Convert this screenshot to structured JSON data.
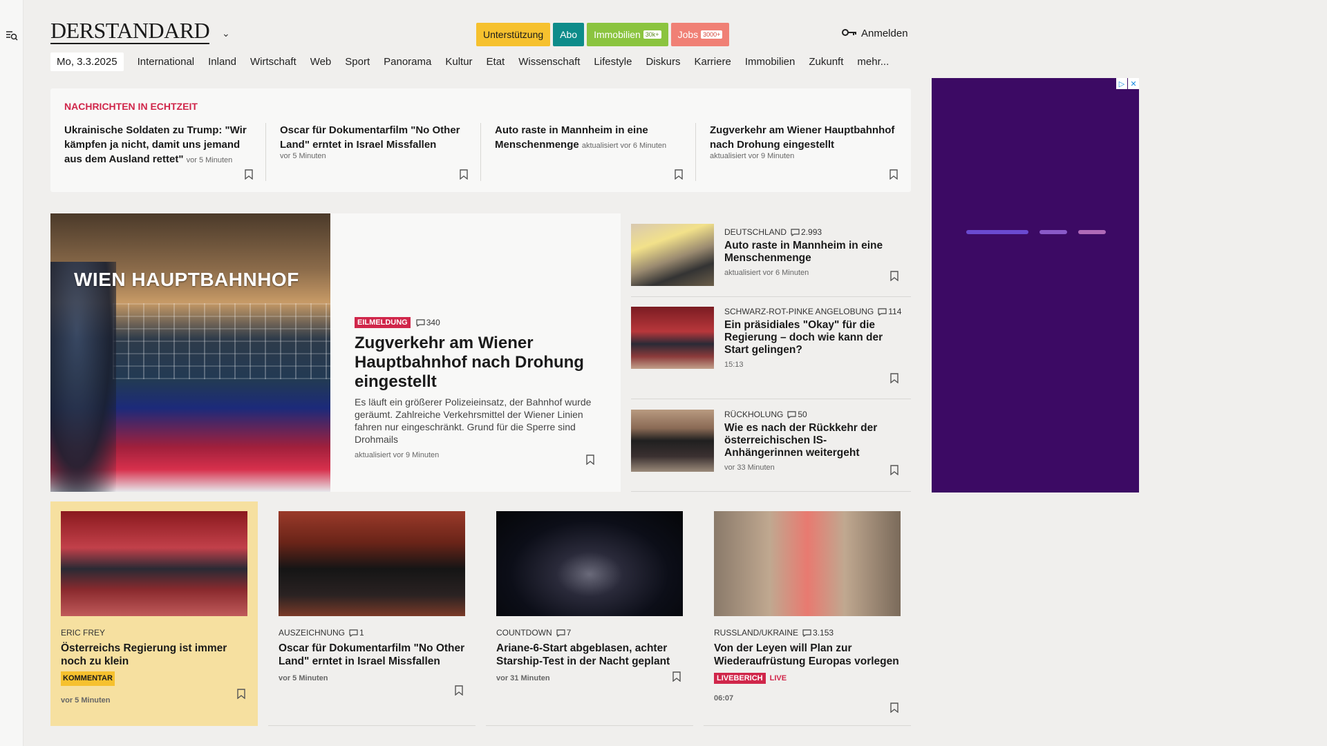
{
  "site": {
    "logo": "DERSTANDARD"
  },
  "top_buttons": {
    "support": "Unterstützung",
    "abo": "Abo",
    "immobilien": "Immobilien",
    "immobilien_tag": "30k+",
    "jobs": "Jobs",
    "jobs_tag": "3000+"
  },
  "login": {
    "label": "Anmelden"
  },
  "nav": {
    "date": "Mo, 3.3.2025",
    "items": [
      "International",
      "Inland",
      "Wirtschaft",
      "Web",
      "Sport",
      "Panorama",
      "Kultur",
      "Etat",
      "Wissenschaft",
      "Lifestyle",
      "Diskurs",
      "Karriere",
      "Immobilien",
      "Zukunft",
      "mehr..."
    ]
  },
  "ticker": {
    "title": "Nachrichten in Echtzeit",
    "items": [
      {
        "headline": "Ukrainische Soldaten zu Trump: \"Wir kämpfen ja nicht, damit uns jemand aus dem Ausland rettet\"",
        "time": "vor 5 Minuten"
      },
      {
        "headline": "Oscar für Dokumentarfilm \"No Other Land\" erntet in Israel Missfallen",
        "time": "vor 5 Minuten"
      },
      {
        "headline": "Auto raste in Mannheim in eine Menschenmenge",
        "time": "aktualisiert vor 6 Minuten"
      },
      {
        "headline": "Zugverkehr am Wiener Hauptbahnhof nach Drohung eingestellt",
        "time": "aktualisiert vor 9 Minuten"
      }
    ]
  },
  "hero": {
    "image_sign": "WIEN HAUPTBAHNHOF",
    "badge": "Eilmeldung",
    "comments": "340",
    "headline": "Zugverkehr am Wiener Hauptbahnhof nach Drohung eingestellt",
    "teaser": "Es läuft ein größerer Polizeieinsatz, der Bahnhof wurde geräumt. Zahlreiche Verkehrsmittel der Wiener Linien fahren nur eingeschränkt. Grund für die Sperre sind Drohmails",
    "time": "aktualisiert vor 9 Minuten"
  },
  "side": [
    {
      "kicker": "Deutschland",
      "comments": "2.993",
      "headline": "Auto raste in Mannheim in eine Menschenmenge",
      "time": "aktualisiert vor 6 Minuten"
    },
    {
      "kicker": "Schwarz-rot-pinke Angelobung",
      "comments": "114",
      "headline": "Ein präsidiales \"Okay\" für die Regierung – doch wie kann der Start gelingen?",
      "time": "15:13"
    },
    {
      "kicker": "Rückholung",
      "comments": "50",
      "headline": "Wie es nach der Rückkehr der österreichischen IS-Anhängerinnen weitergeht",
      "time": "vor 33 Minuten"
    }
  ],
  "cards": [
    {
      "kicker": "Eric Frey",
      "headline": "Österreichs Regierung ist immer noch zu klein",
      "label": "Kommentar",
      "time": "vor 5 Minuten"
    },
    {
      "kicker": "Auszeichnung",
      "comments": "1",
      "headline": "Oscar für Dokumentarfilm \"No Other Land\" erntet in Israel Missfallen",
      "time": "vor 5 Minuten"
    },
    {
      "kicker": "Countdown",
      "comments": "7",
      "headline": "Ariane-6-Start abgeblasen, achter Starship-Test in der Nacht geplant",
      "time": "vor 31 Minuten"
    },
    {
      "kicker": "Russland/Ukraine",
      "comments": "3.153",
      "headline": "Von der Leyen will Plan zur Wiederaufrüstung Europas vorlegen",
      "badge": "Liveberich",
      "live": "LIVE",
      "time": "06:07"
    }
  ],
  "colors": {
    "accent_red": "#d0264a",
    "support_yellow": "#f6c12e",
    "abo_teal": "#0e8c8a",
    "immo_green": "#8bc43f",
    "jobs_coral": "#f08075",
    "ad_purple": "#3c0a64"
  }
}
